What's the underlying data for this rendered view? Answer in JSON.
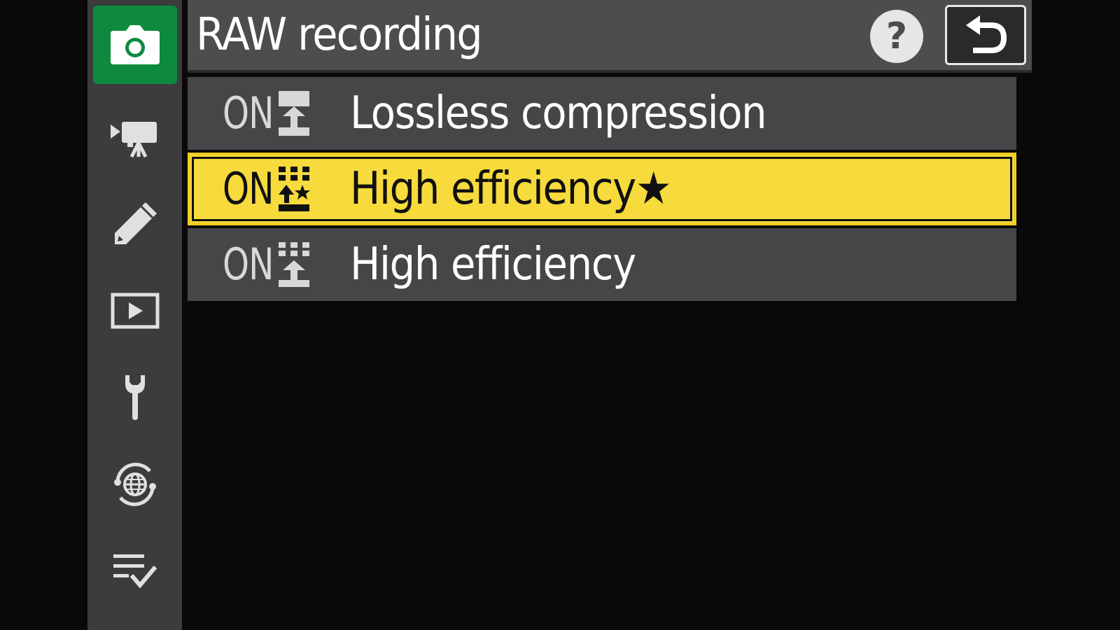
{
  "header": {
    "title": "RAW recording",
    "help_label": "?"
  },
  "sidebar": {
    "items": [
      {
        "icon": "camera-icon",
        "active": true
      },
      {
        "icon": "movie-camera-icon",
        "active": false
      },
      {
        "icon": "pencil-icon",
        "active": false
      },
      {
        "icon": "playback-icon",
        "active": false
      },
      {
        "icon": "wrench-icon",
        "active": false
      },
      {
        "icon": "network-icon",
        "active": false
      },
      {
        "icon": "my-menu-icon",
        "active": false
      }
    ]
  },
  "options": [
    {
      "prefix": "ON",
      "label": "Lossless compression",
      "icon": "lossless-compression-icon",
      "selected": false
    },
    {
      "prefix": "ON",
      "label": "High efficiency★",
      "icon": "high-efficiency-star-icon",
      "selected": true
    },
    {
      "prefix": "ON",
      "label": "High efficiency",
      "icon": "high-efficiency-icon",
      "selected": false
    }
  ],
  "colors": {
    "active_tab": "#0e8a3e",
    "highlight": "#f7da3c",
    "background": "#0a0809"
  }
}
